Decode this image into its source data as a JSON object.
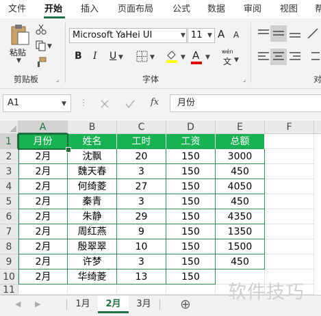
{
  "menu": {
    "items": [
      "文件",
      "开始",
      "插入",
      "页面布局",
      "公式",
      "数据",
      "审阅",
      "视图",
      "帮"
    ],
    "active": "开始"
  },
  "ribbon": {
    "clipboard": {
      "paste_label": "粘贴",
      "group_label": "剪贴板"
    },
    "font": {
      "font_name": "Microsoft YaHei UI",
      "font_size": "11",
      "bold": "B",
      "italic": "I",
      "underline": "U",
      "wen_label": "wén",
      "wen_char": "文",
      "grow": "A",
      "shrink": "A",
      "group_label": "字体"
    },
    "align": {
      "group_label": "对"
    }
  },
  "formula_bar": {
    "name_box": "A1",
    "fx": "fx",
    "value": "月份"
  },
  "sheet": {
    "columns": [
      "A",
      "B",
      "C",
      "D",
      "E",
      "F"
    ],
    "rows": [
      "1",
      "2",
      "3",
      "4",
      "5",
      "6",
      "7",
      "8",
      "9",
      "10",
      "11"
    ],
    "header_row": [
      "月份",
      "姓名",
      "工时",
      "工资",
      "总额"
    ],
    "data": [
      [
        "2月",
        "沈飘",
        "20",
        "150",
        "3000"
      ],
      [
        "2月",
        "魏天春",
        "3",
        "150",
        "450"
      ],
      [
        "2月",
        "何绮菱",
        "27",
        "150",
        "4050"
      ],
      [
        "2月",
        "秦青",
        "3",
        "150",
        "450"
      ],
      [
        "2月",
        "朱静",
        "29",
        "150",
        "4350"
      ],
      [
        "2月",
        "周红燕",
        "9",
        "150",
        "1350"
      ],
      [
        "2月",
        "殷翠翠",
        "10",
        "150",
        "1500"
      ],
      [
        "2月",
        "许梦",
        "3",
        "150",
        "450"
      ],
      [
        "2月",
        "华绮菱",
        "13",
        "150",
        ""
      ]
    ],
    "header_fill": "#19b252",
    "border_color": "#2e8b57"
  },
  "tabs": {
    "sheets": [
      "1月",
      "2月",
      "3月"
    ],
    "active": "2月",
    "add": "⊕"
  },
  "watermark": "软件技巧"
}
